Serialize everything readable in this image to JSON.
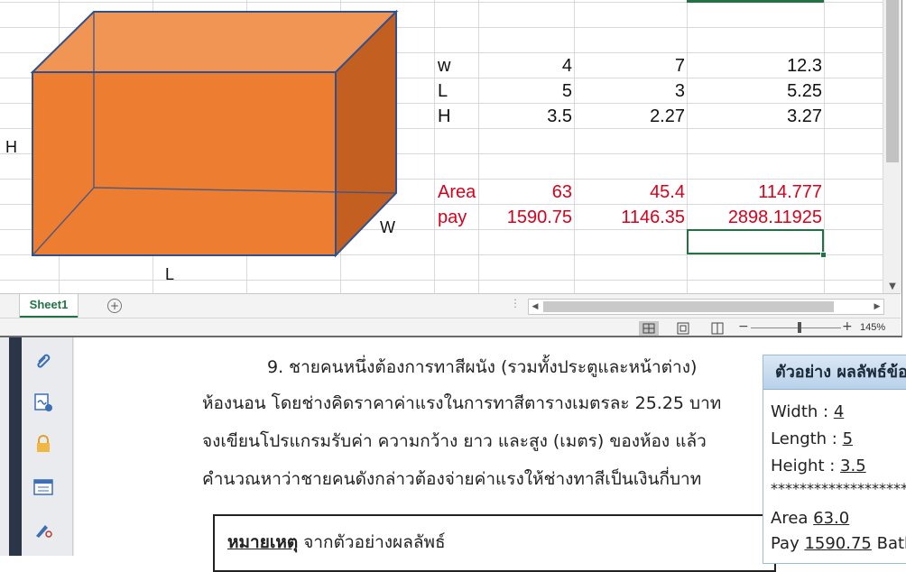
{
  "excel": {
    "shape_labels": {
      "h": "H",
      "w": "W",
      "l": "L"
    },
    "rows": [
      {
        "label": "w",
        "values": [
          "4",
          "7",
          "12.3"
        ],
        "color": "black"
      },
      {
        "label": "L",
        "values": [
          "5",
          "3",
          "5.25"
        ],
        "color": "black"
      },
      {
        "label": "H",
        "values": [
          "3.5",
          "2.27",
          "3.27"
        ],
        "color": "black"
      },
      {
        "label": "Area",
        "values": [
          "63",
          "45.4",
          "114.777"
        ],
        "color": "red"
      },
      {
        "label": "pay",
        "values": [
          "1590.75",
          "1146.35",
          "2898.11925"
        ],
        "color": "red"
      }
    ],
    "sheet_tab": "Sheet1",
    "add_sheet_symbol": "+",
    "zoom_level": "145%",
    "colors": {
      "accent": "#217346",
      "shape_fill": "#ed7d31",
      "shape_top": "#f19555",
      "shape_side": "#c45f22",
      "shape_edge": "#2f528f",
      "red_text": "#d9001b"
    }
  },
  "document": {
    "lines": [
      "9. ชายคนหนึ่งต้องการทาสีผนัง (รวมทั้งประตูและหน้าต่าง)",
      "ห้องนอน โดยช่างคิดราคาค่าแรงในการทาสีตารางเมตรละ 25.25 บาท",
      "จงเขียนโปรแกรมรับค่า ความกว้าง ยาว และสูง (เมตร) ของห้อง แล้ว",
      "คำนวณหาว่าชายคนดังกล่าวต้องจ่ายค่าแรงให้ช่างทาสีเป็นเงินกี่บาท"
    ],
    "note_label": "หมายเหตุ",
    "note_text": " จากตัวอย่างผลลัพธ์",
    "example": {
      "header": "ตัวอย่าง ผลลัพธ์ข้อ",
      "width_label": "Width : ",
      "width_value": "4",
      "length_label": "Length : ",
      "length_value": "5",
      "height_label": "Height : ",
      "height_value": "3.5",
      "separator": "********************",
      "area_label": "Area ",
      "area_value": "63.0",
      "pay_label": "Pay ",
      "pay_value": "1590.75",
      "pay_unit": " Bath"
    }
  },
  "toolbar_icons": [
    "attach-icon",
    "signature-icon",
    "lock-icon",
    "form-icon",
    "pen-person-icon"
  ]
}
